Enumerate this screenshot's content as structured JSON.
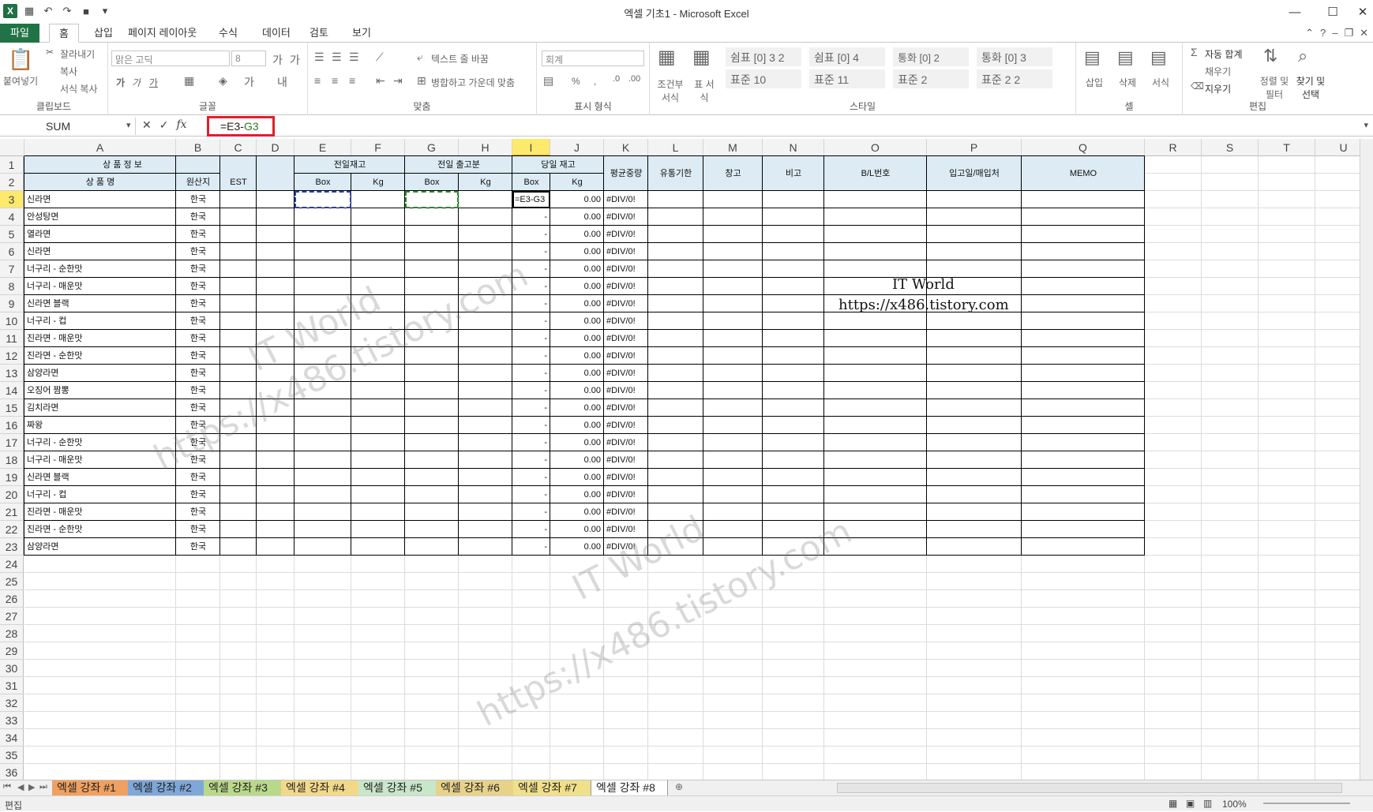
{
  "window": {
    "title": "엑셀 기초1 - Microsoft Excel",
    "controls": [
      "—",
      "☐",
      "✕"
    ]
  },
  "ribbon_tabs": [
    "파일",
    "홈",
    "삽입",
    "페이지 레이아웃",
    "수식",
    "데이터",
    "검토",
    "보기"
  ],
  "ribbon": {
    "clipboard": {
      "paste": "붙여넣기",
      "cut": "잘라내기",
      "copy": "복사",
      "format_painter": "서식 복사",
      "label": "클립보드"
    },
    "font": {
      "name": "맑은 고딕",
      "size": "8",
      "label": "글꼴",
      "bold": "가",
      "italic": "가",
      "underline": "가"
    },
    "align": {
      "wrap": "텍스트 줄 바꿈",
      "merge": "병합하고 가운데 맞춤",
      "label": "맞춤"
    },
    "number": {
      "format": "회계",
      "percent": "%",
      "comma": ",",
      "label": "표시 형식"
    },
    "styles": {
      "cond": "조건부 서식",
      "table": "표 서식",
      "cells": [
        "쉼표 [0] 3 2",
        "쉼표 [0] 4",
        "통화 [0] 2",
        "통화 [0] 3",
        "표준 10",
        "표준 11",
        "표준 2",
        "표준 2 2"
      ],
      "label": "스타일"
    },
    "cells_group": {
      "insert": "삽입",
      "delete": "삭제",
      "format": "서식",
      "label": "셀"
    },
    "edit": {
      "autosum": "자동 합계",
      "fill": "채우기",
      "clear": "지우기",
      "sort": "정렬 및 필터",
      "find": "찾기 및 선택",
      "label": "편집"
    }
  },
  "formula_bar": {
    "name_box": "SUM",
    "formula_prefix": "=E3-",
    "formula_ref": "G3"
  },
  "columns": [
    "A",
    "B",
    "C",
    "D",
    "E",
    "F",
    "G",
    "H",
    "I",
    "J",
    "K",
    "L",
    "M",
    "N",
    "O",
    "P",
    "Q",
    "R",
    "S",
    "T",
    "U"
  ],
  "selected_column": "I",
  "selected_row": 3,
  "rows": [
    "1",
    "2",
    "3",
    "4",
    "5",
    "6",
    "7",
    "8",
    "9",
    "10",
    "11",
    "12",
    "13",
    "14",
    "15",
    "16",
    "17",
    "18",
    "19",
    "20",
    "21",
    "22",
    "23",
    "24",
    "25",
    "26",
    "27",
    "28",
    "29",
    "30",
    "31",
    "32",
    "33",
    "34",
    "35",
    "36"
  ],
  "table_header": {
    "product_info": "상 품 정 보",
    "product_name": "상 품 명",
    "origin": "원산지",
    "est": "EST",
    "prev_stock": "전일재고",
    "prev_out": "전일 출고분",
    "today_stock": "당일 재고",
    "box": "Box",
    "kg": "Kg",
    "avg_weight": "평균중량",
    "expiry": "유통기한",
    "warehouse": "창고",
    "note": "비고",
    "bl": "B/L번호",
    "inbound": "입고일/매입처",
    "memo": "MEMO"
  },
  "data_rows": [
    {
      "name": "신라면",
      "origin": "한국",
      "i": "=E3-G3",
      "j": "0.00",
      "k": "#DIV/0!"
    },
    {
      "name": "안성탕면",
      "origin": "한국",
      "i": "-",
      "j": "0.00",
      "k": "#DIV/0!"
    },
    {
      "name": "열라면",
      "origin": "한국",
      "i": "-",
      "j": "0.00",
      "k": "#DIV/0!"
    },
    {
      "name": "신라면",
      "origin": "한국",
      "i": "-",
      "j": "0.00",
      "k": "#DIV/0!"
    },
    {
      "name": "너구리 - 순한맛",
      "origin": "한국",
      "i": "-",
      "j": "0.00",
      "k": "#DIV/0!"
    },
    {
      "name": "너구리 - 매운맛",
      "origin": "한국",
      "i": "-",
      "j": "0.00",
      "k": "#DIV/0!"
    },
    {
      "name": "신라면 블랙",
      "origin": "한국",
      "i": "-",
      "j": "0.00",
      "k": "#DIV/0!"
    },
    {
      "name": "너구리 - 컵",
      "origin": "한국",
      "i": "-",
      "j": "0.00",
      "k": "#DIV/0!"
    },
    {
      "name": "진라면 - 매운맛",
      "origin": "한국",
      "i": "-",
      "j": "0.00",
      "k": "#DIV/0!"
    },
    {
      "name": "진라면 - 순한맛",
      "origin": "한국",
      "i": "-",
      "j": "0.00",
      "k": "#DIV/0!"
    },
    {
      "name": "삼양라면",
      "origin": "한국",
      "i": "-",
      "j": "0.00",
      "k": "#DIV/0!"
    },
    {
      "name": "오징어 짬뽕",
      "origin": "한국",
      "i": "-",
      "j": "0.00",
      "k": "#DIV/0!"
    },
    {
      "name": "김치라면",
      "origin": "한국",
      "i": "-",
      "j": "0.00",
      "k": "#DIV/0!"
    },
    {
      "name": "짜왕",
      "origin": "한국",
      "i": "-",
      "j": "0.00",
      "k": "#DIV/0!"
    },
    {
      "name": "너구리 - 순한맛",
      "origin": "한국",
      "i": "-",
      "j": "0.00",
      "k": "#DIV/0!"
    },
    {
      "name": "너구리 - 매운맛",
      "origin": "한국",
      "i": "-",
      "j": "0.00",
      "k": "#DIV/0!"
    },
    {
      "name": "신라면 블랙",
      "origin": "한국",
      "i": "-",
      "j": "0.00",
      "k": "#DIV/0!"
    },
    {
      "name": "너구리 - 컵",
      "origin": "한국",
      "i": "-",
      "j": "0.00",
      "k": "#DIV/0!"
    },
    {
      "name": "진라면 - 매운맛",
      "origin": "한국",
      "i": "-",
      "j": "0.00",
      "k": "#DIV/0!"
    },
    {
      "name": "진라면 - 순한맛",
      "origin": "한국",
      "i": "-",
      "j": "0.00",
      "k": "#DIV/0!"
    },
    {
      "name": "삼양라면",
      "origin": "한국",
      "i": "-",
      "j": "0.00",
      "k": "#DIV/0!"
    }
  ],
  "overlay": {
    "line1": "IT World",
    "line2": "https://x486.tistory.com"
  },
  "watermarks": [
    "IT World",
    "https://x486.tistory.com"
  ],
  "sheet_tabs": [
    {
      "label": "엑셀 강좌 #1",
      "color": "#f0a060"
    },
    {
      "label": "엑셀 강좌 #2",
      "color": "#7fa7d8"
    },
    {
      "label": "엑셀 강좌 #3",
      "color": "#b9d98a"
    },
    {
      "label": "엑셀 강좌 #4",
      "color": "#f2d98a"
    },
    {
      "label": "엑셀 강좌 #5",
      "color": "#c8e6c9"
    },
    {
      "label": "엑셀 강좌 #6",
      "color": "#e8d28a"
    },
    {
      "label": "엑셀 강좌 #7",
      "color": "#f0e08a"
    },
    {
      "label": "엑셀 강좌 #8",
      "color": "#ffffff"
    }
  ],
  "status": {
    "mode": "편집",
    "zoom": "100%"
  },
  "colors": {
    "excel_green": "#217346",
    "header_fill": "#dcebf4",
    "selection_yellow": "#fde96b",
    "highlight_red": "#e0202a"
  }
}
